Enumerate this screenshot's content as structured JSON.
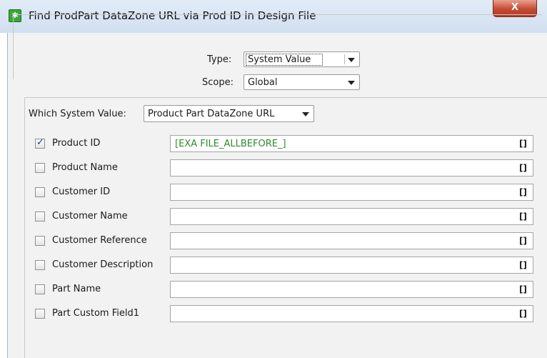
{
  "window": {
    "title": "Find ProdPart DataZone URL via Prod ID in Design File",
    "close_glyph": "X",
    "app_icon": "gear-icon"
  },
  "form": {
    "type_label": "Type:",
    "type_value": "System Value",
    "scope_label": "Scope:",
    "scope_value": "Global",
    "which_label": "Which System Value:",
    "which_value": "Product Part DataZone URL"
  },
  "rows": [
    {
      "label": "Product ID",
      "checked": true,
      "value": "[EXA FILE_ALLBEFORE_]",
      "bracket": "[]"
    },
    {
      "label": "Product Name",
      "checked": false,
      "value": "",
      "bracket": "[]"
    },
    {
      "label": "Customer ID",
      "checked": false,
      "value": "",
      "bracket": "[]"
    },
    {
      "label": "Customer Name",
      "checked": false,
      "value": "",
      "bracket": "[]"
    },
    {
      "label": "Customer Reference",
      "checked": false,
      "value": "",
      "bracket": "[]"
    },
    {
      "label": "Customer Description",
      "checked": false,
      "value": "",
      "bracket": "[]"
    },
    {
      "label": "Part Name",
      "checked": false,
      "value": "",
      "bracket": "[]"
    },
    {
      "label": "Part Custom Field1",
      "checked": false,
      "value": "",
      "bracket": "[]"
    }
  ],
  "colors": {
    "value_text": "#2e8b2e",
    "checkmark": "#1f3f7a",
    "close_button": "#c64a33"
  }
}
